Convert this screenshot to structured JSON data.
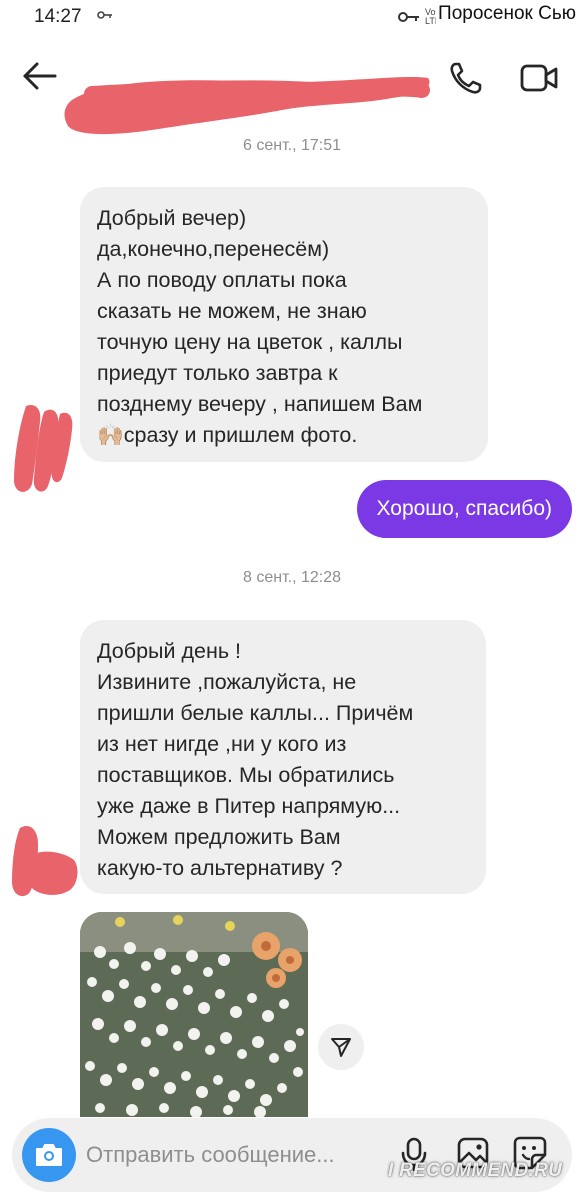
{
  "status_bar": {
    "time": "14:27",
    "network": "Vo\nLTE1",
    "carrier": "Поросенок Сью"
  },
  "header": {
    "contact_name_redacted": true
  },
  "messages": [
    {
      "type": "timestamp",
      "text": "6 сент., 17:51"
    },
    {
      "type": "incoming",
      "text": "Добрый вечер)\nда,конечно,перенесём)\nА по поводу оплаты пока\nсказать не можем, не знаю\nточную цену на цветок , каллы\nприедут только завтра к\nпозднему вечеру , напишем Вам\n🙌🏼сразу и пришлем фото."
    },
    {
      "type": "outgoing",
      "text": "Хорошо,  спасибо)"
    },
    {
      "type": "timestamp",
      "text": "8 сент., 12:28"
    },
    {
      "type": "incoming",
      "text": "Добрый день !\nИзвините ,пожалуйста, не\nпришли белые каллы... Причём\nиз нет нигде ,ни у кого из\nпоставщиков. Мы обратились\nуже даже в Питер напрямую...\nМожем предложить Вам\nкакую-то альтернативу ?"
    },
    {
      "type": "incoming_photo",
      "description_icon": "gypsophila-photo"
    }
  ],
  "composer": {
    "placeholder": "Отправить сообщение..."
  },
  "watermark": "I RECOMMEND.RU",
  "colors": {
    "accent_purple": "#7b39e6",
    "bubble_gray": "#efefef",
    "camera_blue": "#3797f0",
    "redaction": "#e8636a"
  }
}
